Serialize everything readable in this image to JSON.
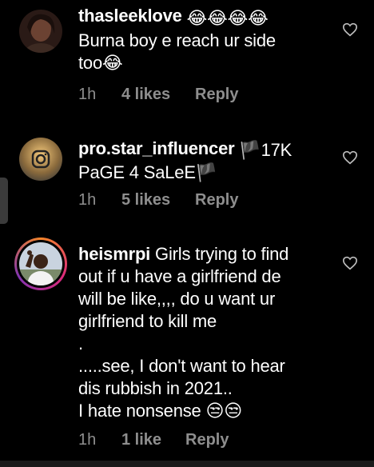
{
  "comments": [
    {
      "username": "thasleeklove",
      "username_suffix": "😂😂😂😂",
      "line1": "Burna boy e reach ur side",
      "line2": "too😂",
      "time": "1h",
      "likes": "4 likes",
      "reply": "Reply"
    },
    {
      "username": "pro.star_influencer",
      "username_suffix": "🏴17K",
      "line1": "PaGE 4 SaLeE🏴",
      "time": "1h",
      "likes": "5 likes",
      "reply": "Reply"
    },
    {
      "username": "heismrpi",
      "lines": [
        "Girls trying to find",
        "out if u have a girlfriend de",
        "will be like,,,, do u want ur",
        "girlfriend to kill me",
        ".",
        ".....see, I don't want to hear",
        "dis rubbish in 2021..",
        "I hate nonsense 😒😒"
      ],
      "time": "1h",
      "likes": "1 like",
      "reply": "Reply"
    }
  ],
  "colors": {
    "background": "#000000",
    "text": "#ffffff",
    "meta": "#8e8e8e"
  },
  "icons": [
    "heart-outline-icon",
    "black-flag-icon",
    "laughing-emoji-icon",
    "unamused-emoji-icon"
  ]
}
